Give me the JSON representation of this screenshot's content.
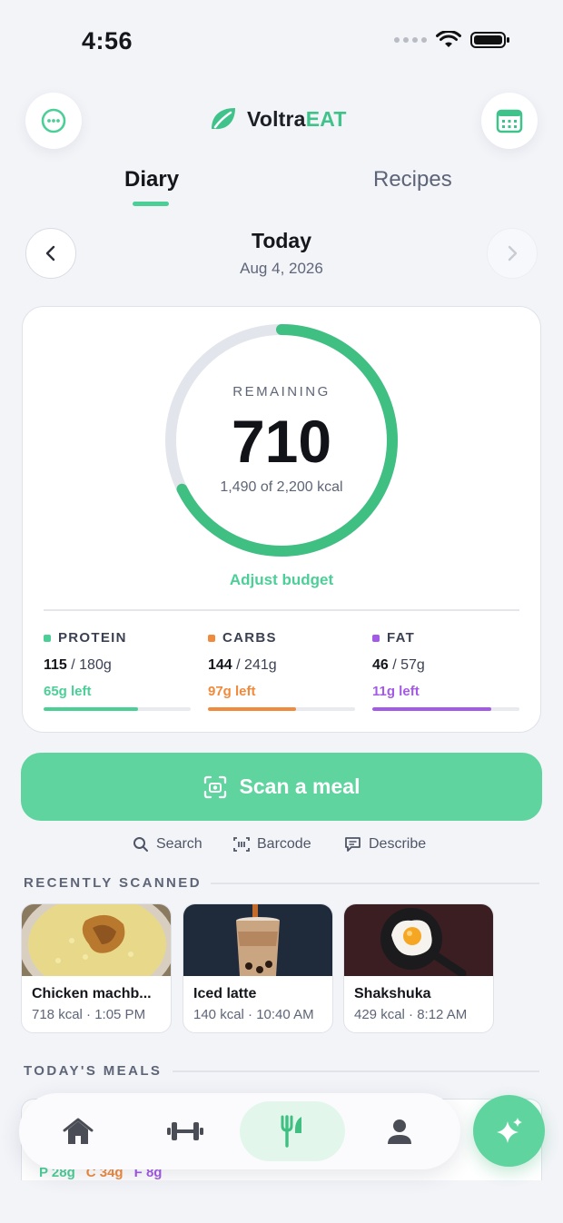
{
  "status": {
    "time": "4:56"
  },
  "brand": {
    "name_part1": "Voltra",
    "name_part2": "EAT"
  },
  "tabs": [
    {
      "label": "Diary",
      "active": true
    },
    {
      "label": "Recipes",
      "active": false
    }
  ],
  "date": {
    "title": "Today",
    "subtitle": "Aug 4, 2026"
  },
  "summary": {
    "remaining_label": "REMAINING",
    "remaining_value": "710",
    "consumed_text": "1,490 of 2,200 kcal",
    "consumed_fraction": 0.677,
    "adjust_label": "Adjust budget"
  },
  "macros": [
    {
      "name": "PROTEIN",
      "eaten": "115",
      "goal": " / 180g",
      "left": "65g left",
      "color": "#4ccf97",
      "progress": 0.64
    },
    {
      "name": "CARBS",
      "eaten": "144",
      "goal": " / 241g",
      "left": "97g left",
      "color": "#f08a3c",
      "progress": 0.6
    },
    {
      "name": "FAT",
      "eaten": "46",
      "goal": " / 57g",
      "left": "11g left",
      "color": "#a35ae6",
      "progress": 0.81
    }
  ],
  "scan": {
    "label": "Scan a meal"
  },
  "quick_actions": {
    "search": "Search",
    "barcode": "Barcode",
    "describe": "Describe"
  },
  "recent": {
    "title": "RECENTLY SCANNED",
    "items": [
      {
        "name": "Chicken machb...",
        "meta": "718 kcal · 1:05 PM"
      },
      {
        "name": "Iced latte",
        "meta": "140 kcal · 10:40 AM"
      },
      {
        "name": "Shakshuka",
        "meta": "429 kcal · 8:12 AM"
      }
    ]
  },
  "meals": {
    "title": "TODAY'S MEALS",
    "peek_macros": {
      "p": "P 28g",
      "c": "C 34g",
      "f": "F 8g"
    }
  },
  "colors": {
    "accent": "#5fd49f",
    "protein": "#4ccf97",
    "carbs": "#f08a3c",
    "fat": "#a35ae6"
  }
}
